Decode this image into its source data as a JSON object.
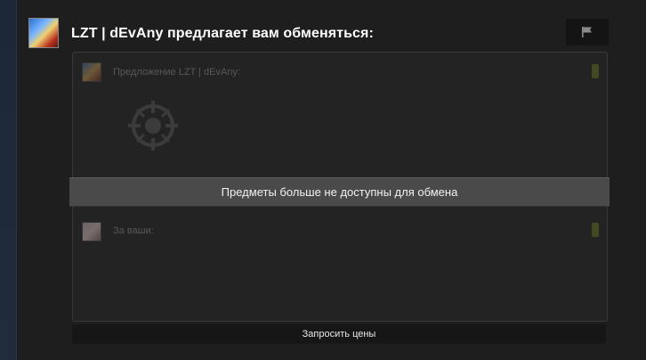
{
  "header": {
    "title": "LZT | dEvAny предлагает вам обменяться:",
    "avatar_icon": "user-avatar",
    "flag_icon": "flag-icon"
  },
  "trade": {
    "their_offer_label": "Предложение LZT | dEvAny:",
    "your_offer_label": "За ваши:",
    "unavailable_message": "Предметы больше не доступны для обмена",
    "ready_indicator_color": "#4e5220"
  },
  "footer": {
    "request_prices_label": "Запросить цены"
  },
  "colors": {
    "background": "#1e1e1e",
    "panel": "#232323",
    "banner": "#4a4a4a",
    "button": "#161616",
    "title_text": "#ffffff",
    "muted_text": "#585858"
  }
}
